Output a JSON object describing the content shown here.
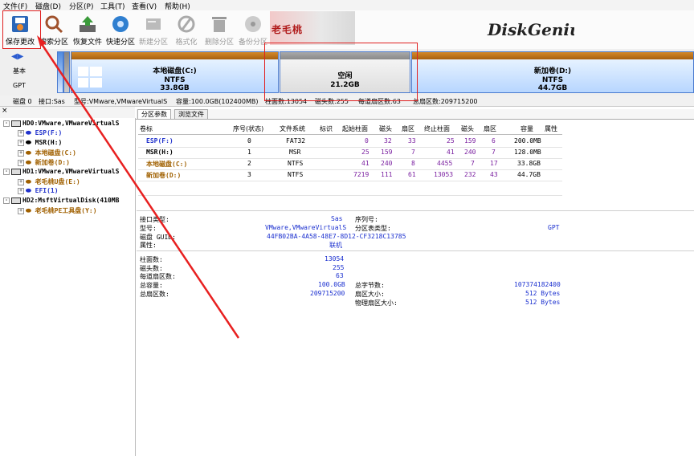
{
  "menu": [
    "文件(F)",
    "磁盘(D)",
    "分区(P)",
    "工具(T)",
    "查看(V)",
    "帮助(H)"
  ],
  "toolbar": [
    {
      "label": "保存更改",
      "icon": "save-icon"
    },
    {
      "label": "搜索分区",
      "icon": "search-icon"
    },
    {
      "label": "恢复文件",
      "icon": "recover-icon"
    },
    {
      "label": "快速分区",
      "icon": "quick-partition-icon"
    },
    {
      "label": "新建分区",
      "icon": "new-partition-icon"
    },
    {
      "label": "格式化",
      "icon": "format-icon"
    },
    {
      "label": "删除分区",
      "icon": "trash-icon"
    },
    {
      "label": "备份分区",
      "icon": "backup-icon"
    }
  ],
  "logo_text": "老毛桃",
  "brand_text": "DiskGenius",
  "disk_bar": {
    "side_labels": [
      "基本",
      "GPT"
    ],
    "segments": [
      {
        "name": "本地磁盘(C:)",
        "fs": "NTFS",
        "size": "33.8GB"
      },
      {
        "name": "空闲",
        "fs": "",
        "size": "21.2GB"
      },
      {
        "name": "新加卷(D:)",
        "fs": "NTFS",
        "size": "44.7GB"
      }
    ]
  },
  "disk_info": [
    "磁盘 0",
    "接口:Sas",
    "型号:VMware,VMwareVirtualS",
    "容量:100.0GB(102400MB)",
    "柱面数:13054",
    "磁头数:255",
    "每道扇区数:63",
    "总扇区数:209715200"
  ],
  "tree": [
    {
      "label": "HD0:VMware,VMwareVirtualS",
      "level": 0,
      "color": "#000000"
    },
    {
      "label": "ESP(F:)",
      "level": 1,
      "color": "#2233cc"
    },
    {
      "label": "MSR(H:)",
      "level": 1,
      "color": "#000000"
    },
    {
      "label": "本地磁盘(C:)",
      "level": 1,
      "color": "#a06000"
    },
    {
      "label": "新加卷(D:)",
      "level": 1,
      "color": "#a06000"
    },
    {
      "label": "HD1:VMware,VMwareVirtualS",
      "level": 0,
      "color": "#000000"
    },
    {
      "label": "老毛桃U盘(E:)",
      "level": 1,
      "color": "#a06000"
    },
    {
      "label": "EFI(1)",
      "level": 1,
      "color": "#2233cc"
    },
    {
      "label": "HD2:MsftVirtualDisk(410MB",
      "level": 0,
      "color": "#000000"
    },
    {
      "label": "老毛桃PE工具盘(Y:)",
      "level": 1,
      "color": "#a06000"
    }
  ],
  "tabs": [
    "分区参数",
    "浏览文件"
  ],
  "table": {
    "headers": [
      "卷标",
      "序号(状态)",
      "文件系统",
      "标识",
      "起始柱面",
      "磁头",
      "扇区",
      "终止柱面",
      "磁头",
      "扇区",
      "容量",
      "属性"
    ],
    "rows": [
      {
        "label": "ESP(F:)",
        "color": "#2233cc",
        "cells": [
          "0",
          "FAT32",
          "",
          "0",
          "32",
          "33",
          "25",
          "159",
          "6",
          "200.0MB",
          ""
        ]
      },
      {
        "label": "MSR(H:)",
        "color": "#000000",
        "cells": [
          "1",
          "MSR",
          "",
          "25",
          "159",
          "7",
          "41",
          "240",
          "7",
          "128.0MB",
          ""
        ]
      },
      {
        "label": "本地磁盘(C:)",
        "color": "#a06000",
        "cells": [
          "2",
          "NTFS",
          "",
          "41",
          "240",
          "8",
          "4455",
          "7",
          "17",
          "33.8GB",
          ""
        ]
      },
      {
        "label": "新加卷(D:)",
        "color": "#a06000",
        "cells": [
          "3",
          "NTFS",
          "",
          "7219",
          "111",
          "61",
          "13053",
          "232",
          "43",
          "44.7GB",
          ""
        ]
      }
    ]
  },
  "details": {
    "interface_label": "接口类型:",
    "interface": "Sas",
    "serial_label": "序列号:",
    "model_label": "型号:",
    "model": "VMware,VMwareVirtualS",
    "parttable_label": "分区表类型:",
    "parttable": "GPT",
    "guid_label": "磁盘 GUID:",
    "guid": "44FB02BA-4A58-48E7-8D12-CF3218C13785",
    "attr_label": "属性:",
    "attr": "联机",
    "cyl_label": "柱面数:",
    "cyl": "13054",
    "heads_label": "磁头数:",
    "heads": "255",
    "spt_label": "每道扇区数:",
    "spt": "63",
    "cap_label": "总容量:",
    "cap": "100.0GB",
    "bytes_label": "总字节数:",
    "bytes": "107374182400",
    "sectors_label": "总扇区数:",
    "sectors": "209715200",
    "secsize_label": "扇区大小:",
    "secsize": "512 Bytes",
    "physec_label": "物理扇区大小:",
    "physec": "512 Bytes"
  }
}
